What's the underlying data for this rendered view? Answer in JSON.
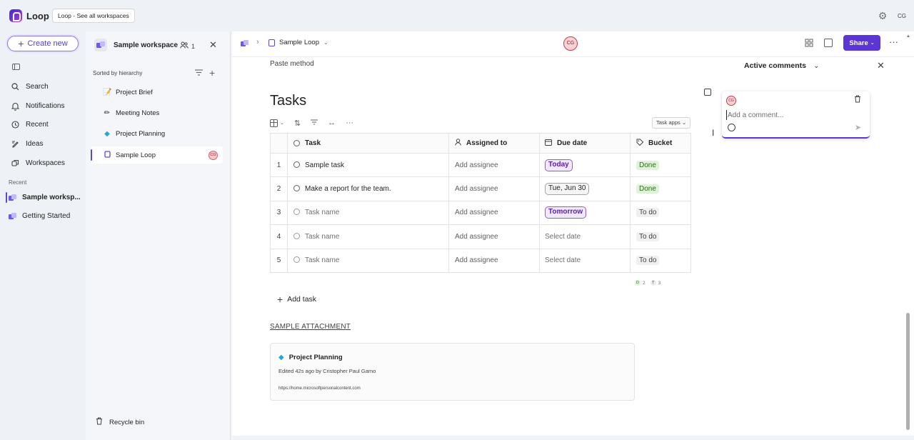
{
  "app": {
    "name": "Loop",
    "tooltip": "Loop - See all workspaces",
    "user_initials": "CG"
  },
  "leftnav": {
    "create_label": "Create new",
    "items": [
      {
        "label": "Search",
        "icon": "search-icon"
      },
      {
        "label": "Notifications",
        "icon": "bell-icon"
      },
      {
        "label": "Recent",
        "icon": "clock-icon"
      },
      {
        "label": "Ideas",
        "icon": "ideas-icon"
      },
      {
        "label": "Workspaces",
        "icon": "workspaces-icon"
      }
    ],
    "recent_label": "Recent",
    "recent": [
      {
        "label": "Sample worksp..."
      },
      {
        "label": "Getting Started"
      }
    ]
  },
  "workspace": {
    "title": "Sample workspace",
    "members": "1",
    "sorted_label": "Sorted by hierarchy",
    "pages": [
      {
        "label": "Project Brief",
        "icon": "brief-icon"
      },
      {
        "label": "Meeting Notes",
        "icon": "pencil-icon"
      },
      {
        "label": "Project Planning",
        "icon": "diamond-icon"
      },
      {
        "label": "Sample Loop",
        "icon": "loop-page-icon"
      }
    ],
    "recycle_label": "Recycle bin"
  },
  "header": {
    "page_title": "Sample Loop",
    "share_label": "Share",
    "avatar": "CG"
  },
  "doc": {
    "paste_method": "Paste method",
    "tasks_title": "Tasks",
    "task_apps": "Task apps",
    "columns": {
      "task": "Task",
      "assigned": "Assigned to",
      "due": "Due date",
      "bucket": "Bucket"
    },
    "rows": [
      {
        "num": "1",
        "task": "Sample task",
        "assigned": "Add assignee",
        "due": "Today",
        "bucket": "Done"
      },
      {
        "num": "2",
        "task": "Make a report for the team.",
        "assigned": "Add assignee",
        "due": "Tue, Jun 30",
        "bucket": "Done"
      },
      {
        "num": "3",
        "task": "Task name",
        "assigned": "Add assignee",
        "due": "Tomorrow",
        "bucket": "To do"
      },
      {
        "num": "4",
        "task": "Task name",
        "assigned": "Add assignee",
        "due": "Select date",
        "bucket": "To do"
      },
      {
        "num": "5",
        "task": "Task name",
        "assigned": "Add assignee",
        "due": "Select date",
        "bucket": "To do"
      }
    ],
    "summary": {
      "done_letter": "D",
      "done_count": "2",
      "todo_letter": "T",
      "todo_count": "3"
    },
    "add_task": "Add task",
    "attachment_label": "SAMPLE ATTACHMENT",
    "attachment": {
      "title": "Project Planning",
      "meta": "Edited 42s ago by Cristopher Paul Gamo",
      "url": "https://home.microsoftpersonalcontent.com"
    }
  },
  "comments": {
    "heading": "Active comments",
    "avatar": "CG",
    "placeholder": "Add a comment..."
  },
  "colors": {
    "accent": "#5b35d5",
    "done_bg": "#dff3d9",
    "pill_purple": "#8d5cd6"
  }
}
